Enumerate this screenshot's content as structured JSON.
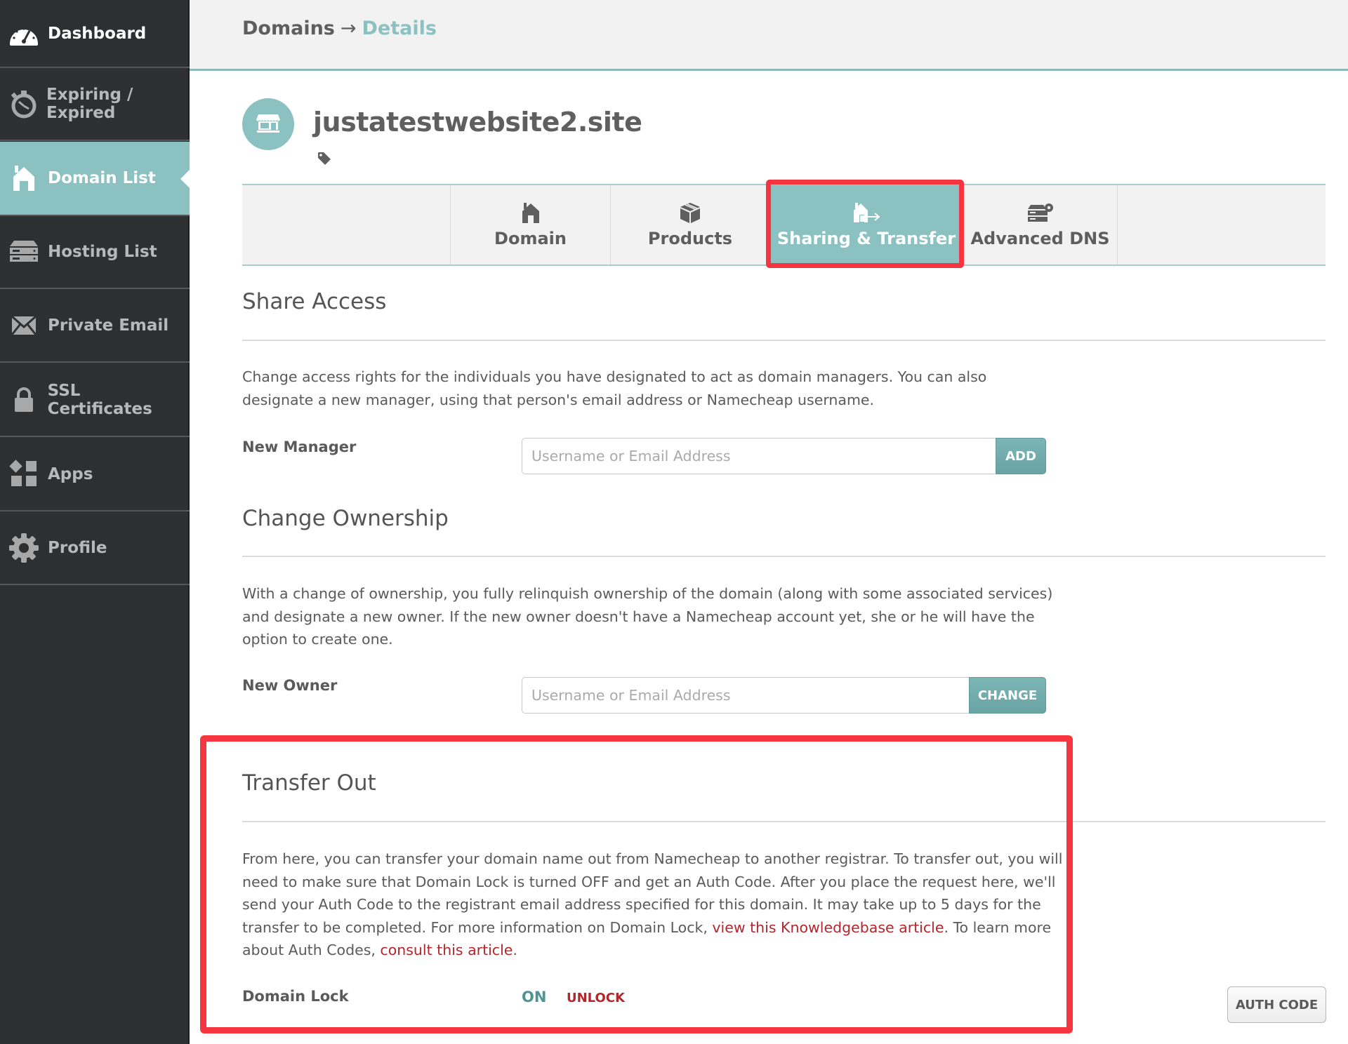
{
  "sidebar": {
    "items": [
      {
        "label": "Dashboard",
        "icon": "dashboard-gauge-icon",
        "active": false
      },
      {
        "label": "Expiring / Expired",
        "icon": "stopwatch-icon",
        "active": false
      },
      {
        "label": "Domain List",
        "icon": "house-icon",
        "active": true
      },
      {
        "label": "Hosting List",
        "icon": "server-icon",
        "active": false
      },
      {
        "label": "Private Email",
        "icon": "envelope-icon",
        "active": false
      },
      {
        "label": "SSL Certificates",
        "icon": "padlock-icon",
        "active": false
      },
      {
        "label": "Apps",
        "icon": "apps-grid-icon",
        "active": false
      },
      {
        "label": "Profile",
        "icon": "gear-icon",
        "active": false
      }
    ]
  },
  "header": {
    "breadcrumb": {
      "root": "Domains",
      "separator": "→",
      "current": "Details"
    }
  },
  "domain": {
    "name": "justatestwebsite2.site",
    "avatar_icon": "storefront-icon",
    "tag_icon": "tag-icon"
  },
  "tabs": [
    {
      "label": "Domain",
      "icon": "house-icon",
      "active": false
    },
    {
      "label": "Products",
      "icon": "box-icon",
      "active": false
    },
    {
      "label": "Sharing & Transfer",
      "icon": "house-transfer-icon",
      "active": true
    },
    {
      "label": "Advanced DNS",
      "icon": "dns-server-gear-icon",
      "active": false
    }
  ],
  "share_access": {
    "title": "Share Access",
    "description": "Change access rights for the individuals you have designated to act as domain managers. You can also designate a new manager, using that person's email address or Namecheap username.",
    "field_label": "New Manager",
    "input_placeholder": "Username or Email Address",
    "input_value": "",
    "button_label": "ADD"
  },
  "change_ownership": {
    "title": "Change Ownership",
    "description": "With a change of ownership, you fully relinquish ownership of the domain (along with some associated services) and designate a new owner. If the new owner doesn't have a Namecheap account yet, she or he will have the option to create one.",
    "field_label": "New Owner",
    "input_placeholder": "Username or Email Address",
    "input_value": "",
    "button_label": "CHANGE"
  },
  "transfer_out": {
    "title": "Transfer Out",
    "description_part1": "From here, you can transfer your domain name out from Namecheap to another registrar. To transfer out, you will need to make sure that Domain Lock is turned OFF and get an Auth Code. After you place the request here, we'll send your Auth Code to the registrant email address specified for this domain. It may take up to 5 days for the transfer to be completed. For more information on Domain Lock, ",
    "link1_text": "view this Knowledgebase article",
    "description_part2": ". To learn more about Auth Codes, ",
    "link2_text": "consult this article",
    "description_part3": ".",
    "domain_lock_label": "Domain Lock",
    "domain_lock_status": "ON",
    "unlock_label": "UNLOCK",
    "auth_code_button": "AUTH CODE"
  },
  "colors": {
    "accent_teal": "#8bc1c1",
    "sidebar_bg": "#2e2f31",
    "link_red": "#b3262b",
    "highlight_red": "#f53641",
    "status_on": "#4f9494"
  }
}
